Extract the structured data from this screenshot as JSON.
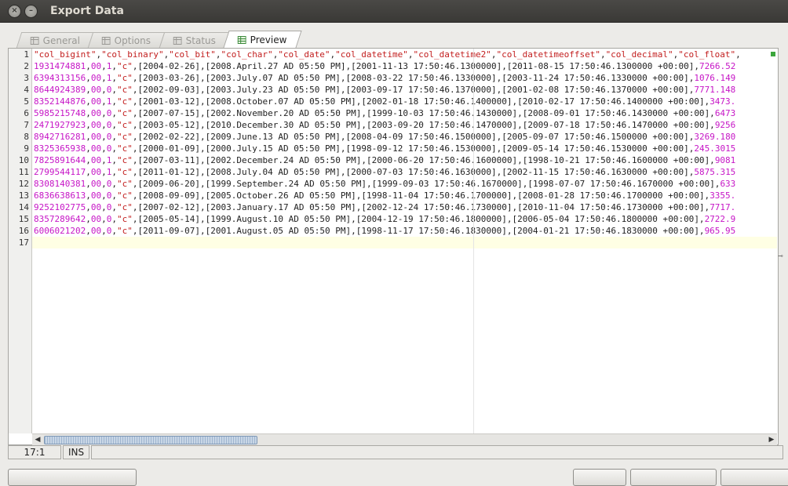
{
  "window": {
    "title": "Export Data"
  },
  "tabs": [
    {
      "label": "General",
      "active": false
    },
    {
      "label": "Options",
      "active": false
    },
    {
      "label": "Status",
      "active": false
    },
    {
      "label": "Preview",
      "active": true
    }
  ],
  "editor": {
    "line_numbers": [
      "1",
      "2",
      "3",
      "4",
      "5",
      "6",
      "7",
      "8",
      "9",
      "10",
      "11",
      "12",
      "13",
      "14",
      "15",
      "16",
      "17"
    ],
    "lines": [
      "\"col_bigint\",\"col_binary\",\"col_bit\",\"col_char\",\"col_date\",\"col_datetime\",\"col_datetime2\",\"col_datetimeoffset\",\"col_decimal\",\"col_float\",",
      "1931474881,00,1,\"c\",[2004-02-26],[2008.April.27 AD 05:50 PM],[2001-11-13 17:50:46.1300000],[2011-08-15 17:50:46.1300000 +00:00],7266.52",
      "6394313156,00,1,\"c\",[2003-03-26],[2003.July.07 AD 05:50 PM],[2008-03-22 17:50:46.1330000],[2003-11-24 17:50:46.1330000 +00:00],1076.149",
      "8644924389,00,0,\"c\",[2002-09-03],[2003.July.23 AD 05:50 PM],[2003-09-17 17:50:46.1370000],[2001-02-08 17:50:46.1370000 +00:00],7771.148",
      "8352144876,00,1,\"c\",[2001-03-12],[2008.October.07 AD 05:50 PM],[2002-01-18 17:50:46.1400000],[2010-02-17 17:50:46.1400000 +00:00],3473.",
      "5985215748,00,0,\"c\",[2007-07-15],[2002.November.20 AD 05:50 PM],[1999-10-03 17:50:46.1430000],[2008-09-01 17:50:46.1430000 +00:00],6473",
      "2471927923,00,0,\"c\",[2003-05-12],[2010.December.30 AD 05:50 PM],[2003-09-20 17:50:46.1470000],[2009-07-18 17:50:46.1470000 +00:00],9256",
      "8942716281,00,0,\"c\",[2002-02-22],[2009.June.13 AD 05:50 PM],[2008-04-09 17:50:46.1500000],[2005-09-07 17:50:46.1500000 +00:00],3269.180",
      "8325365938,00,0,\"c\",[2000-01-09],[2000.July.15 AD 05:50 PM],[1998-09-12 17:50:46.1530000],[2009-05-14 17:50:46.1530000 +00:00],245.3015",
      "7825891644,00,1,\"c\",[2007-03-11],[2002.December.24 AD 05:50 PM],[2000-06-20 17:50:46.1600000],[1998-10-21 17:50:46.1600000 +00:00],9081",
      "2799544117,00,1,\"c\",[2011-01-12],[2008.July.04 AD 05:50 PM],[2000-07-03 17:50:46.1630000],[2002-11-15 17:50:46.1630000 +00:00],5875.315",
      "8308140381,00,0,\"c\",[2009-06-20],[1999.September.24 AD 05:50 PM],[1999-09-03 17:50:46.1670000],[1998-07-07 17:50:46.1670000 +00:00],633",
      "6836638613,00,0,\"c\",[2008-09-09],[2005.October.26 AD 05:50 PM],[1998-11-04 17:50:46.1700000],[2008-01-28 17:50:46.1700000 +00:00],3355.",
      "9252102775,00,0,\"c\",[2007-02-12],[2003.January.17 AD 05:50 PM],[2002-12-24 17:50:46.1730000],[2010-11-04 17:50:46.1730000 +00:00],7717.",
      "8357289642,00,0,\"c\",[2005-05-14],[1999.August.10 AD 05:50 PM],[2004-12-19 17:50:46.1800000],[2006-05-04 17:50:46.1800000 +00:00],2722.9",
      "6006021202,00,0,\"c\",[2011-09-07],[2001.August.05 AD 05:50 PM],[1998-11-17 17:50:46.1830000],[2004-01-21 17:50:46.1830000 +00:00],965.95",
      ""
    ]
  },
  "status": {
    "position": "17:1",
    "mode": "INS"
  },
  "colors": {
    "string": "#c21e1e",
    "number": "#c615c6",
    "current_line": "#ffffe4"
  }
}
